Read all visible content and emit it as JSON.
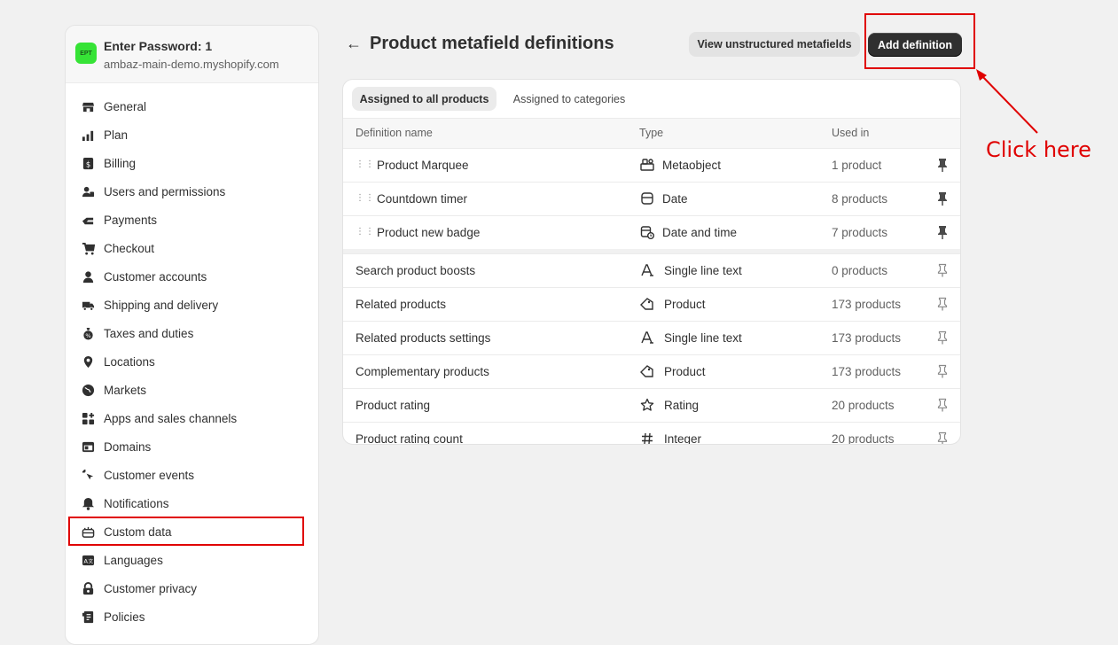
{
  "store": {
    "logo_text": "EPT",
    "name": "Enter Password: 1",
    "domain": "ambaz-main-demo.myshopify.com"
  },
  "nav": [
    {
      "label": "General",
      "icon": "store-icon"
    },
    {
      "label": "Plan",
      "icon": "plan-icon"
    },
    {
      "label": "Billing",
      "icon": "billing-icon"
    },
    {
      "label": "Users and permissions",
      "icon": "users-icon"
    },
    {
      "label": "Payments",
      "icon": "payments-icon"
    },
    {
      "label": "Checkout",
      "icon": "cart-icon"
    },
    {
      "label": "Customer accounts",
      "icon": "person-icon"
    },
    {
      "label": "Shipping and delivery",
      "icon": "truck-icon"
    },
    {
      "label": "Taxes and duties",
      "icon": "taxes-icon"
    },
    {
      "label": "Locations",
      "icon": "location-icon"
    },
    {
      "label": "Markets",
      "icon": "globe-icon"
    },
    {
      "label": "Apps and sales channels",
      "icon": "apps-icon"
    },
    {
      "label": "Domains",
      "icon": "domains-icon"
    },
    {
      "label": "Customer events",
      "icon": "cursor-icon"
    },
    {
      "label": "Notifications",
      "icon": "bell-icon"
    },
    {
      "label": "Custom data",
      "icon": "custom-data-icon"
    },
    {
      "label": "Languages",
      "icon": "languages-icon"
    },
    {
      "label": "Customer privacy",
      "icon": "lock-icon"
    },
    {
      "label": "Policies",
      "icon": "policies-icon"
    }
  ],
  "header": {
    "back": "←",
    "title": "Product metafield definitions",
    "secondary_button": "View unstructured metafields",
    "primary_button": "Add definition"
  },
  "annotation": {
    "text": "Click here",
    "color": "#e00000"
  },
  "tabs": [
    "Assigned to all products",
    "Assigned to categories"
  ],
  "columns": {
    "name": "Definition name",
    "type": "Type",
    "used": "Used in"
  },
  "pinned_rows": [
    {
      "name": "Product Marquee",
      "type": "Metaobject",
      "type_icon": "metaobject-icon",
      "used": "1 product"
    },
    {
      "name": "Countdown timer",
      "type": "Date",
      "type_icon": "calendar-icon",
      "used": "8 products"
    },
    {
      "name": "Product new badge",
      "type": "Date and time",
      "type_icon": "calendar-clock-icon",
      "used": "7 products"
    }
  ],
  "rows": [
    {
      "name": "Search product boosts",
      "type": "Single line text",
      "type_icon": "text-icon",
      "used": "0 products"
    },
    {
      "name": "Related products",
      "type": "Product",
      "type_icon": "product-tag-icon",
      "used": "173 products"
    },
    {
      "name": "Related products settings",
      "type": "Single line text",
      "type_icon": "text-icon",
      "used": "173 products"
    },
    {
      "name": "Complementary products",
      "type": "Product",
      "type_icon": "product-tag-icon",
      "used": "173 products"
    },
    {
      "name": "Product rating",
      "type": "Rating",
      "type_icon": "star-icon",
      "used": "20 products"
    },
    {
      "name": "Product rating count",
      "type": "Integer",
      "type_icon": "hash-icon",
      "used": "20 products"
    }
  ]
}
